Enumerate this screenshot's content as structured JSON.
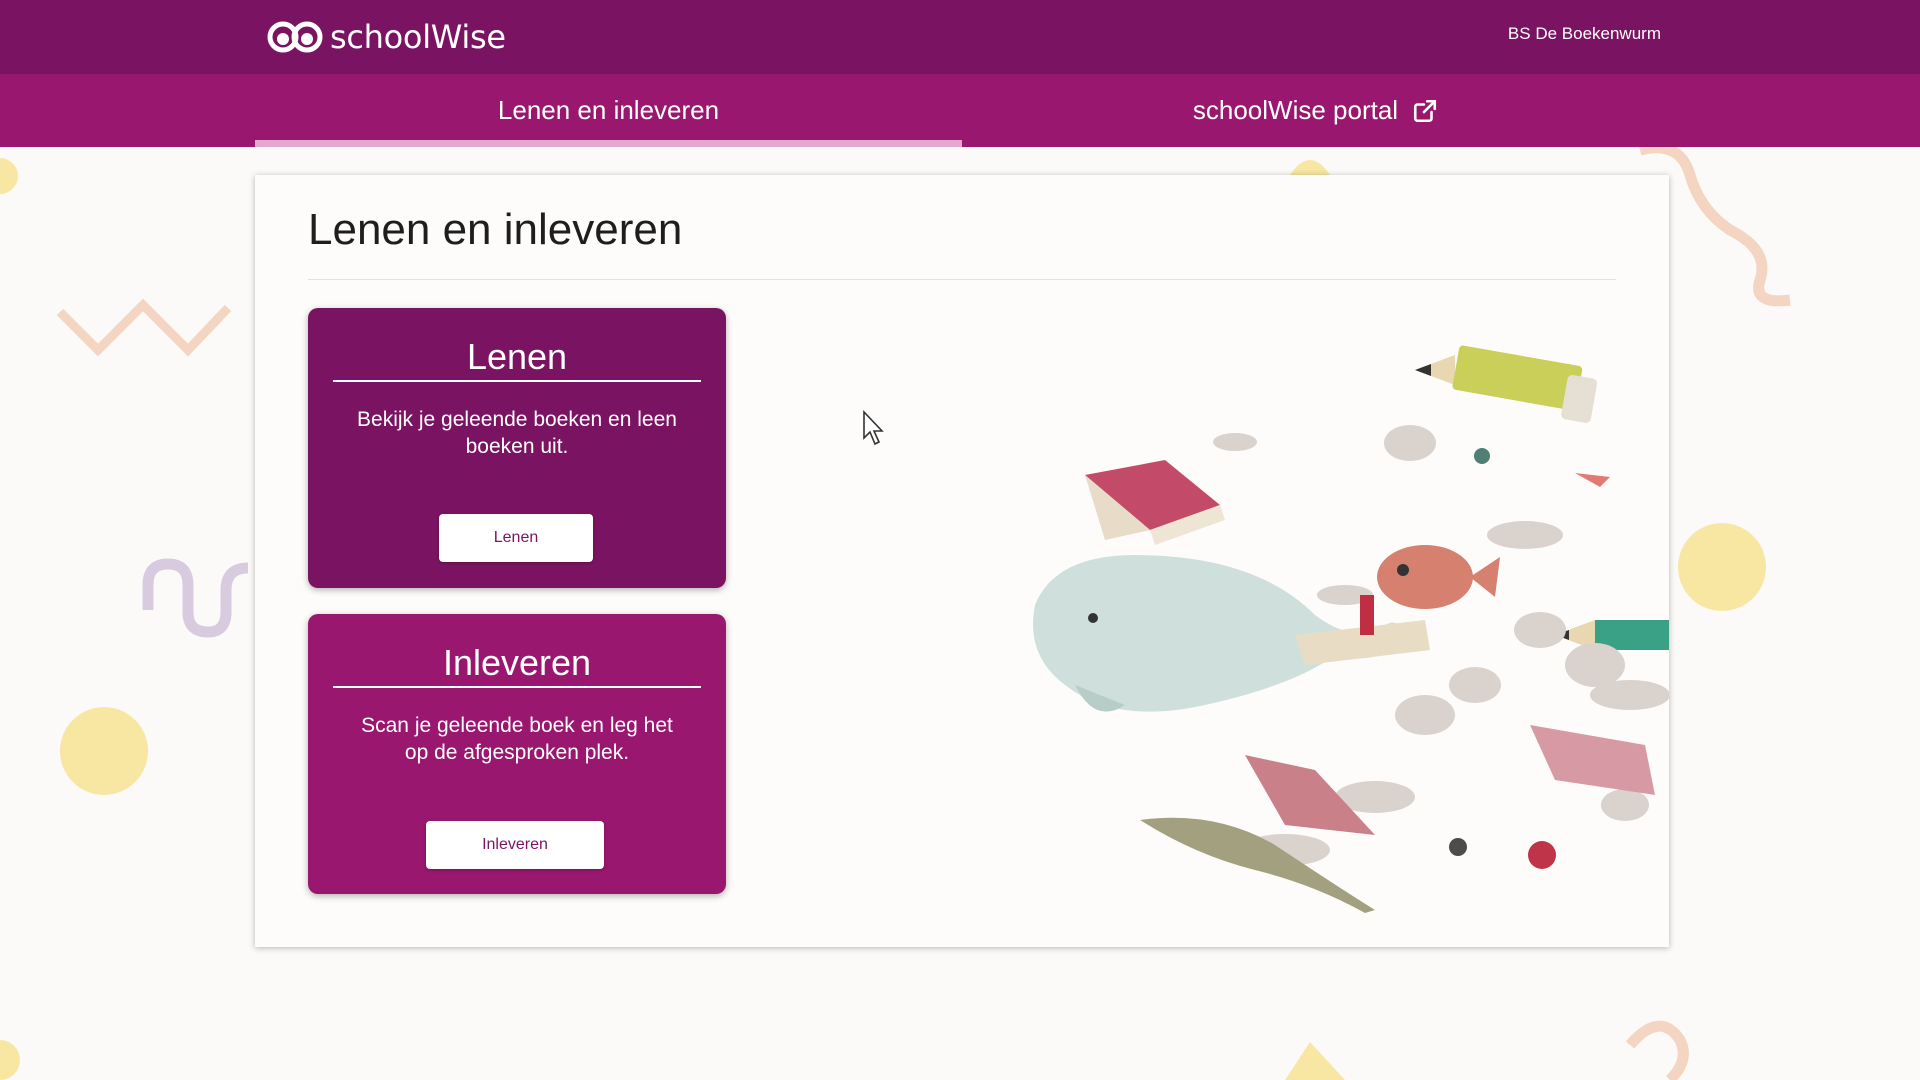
{
  "brand": {
    "logo_text": "schoolWise",
    "color_primary": "#7a1462",
    "color_secondary": "#99176f"
  },
  "header": {
    "school_name": "BS De Boekenwurm"
  },
  "tabs": [
    {
      "label": "Lenen en inleveren",
      "active": true
    },
    {
      "label": "schoolWise portal",
      "icon": "external-link-icon",
      "active": false
    }
  ],
  "main": {
    "title": "Lenen en inleveren",
    "cards": [
      {
        "title": "Lenen",
        "description": "Bekijk je geleende boeken en leen boeken uit.",
        "button_label": "Lenen"
      },
      {
        "title": "Inleveren",
        "description": "Scan je geleende boek en leg het op de afgesproken plek.",
        "button_label": "Inleveren"
      }
    ],
    "illustration": "flying-books-illustration"
  }
}
